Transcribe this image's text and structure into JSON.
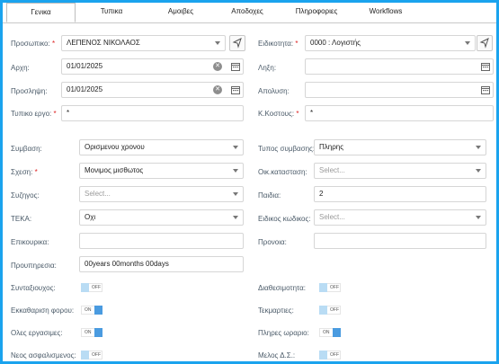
{
  "tabs": [
    "Γενικα",
    "Τυπικα",
    "Αμοιβες",
    "Αποδοχες",
    "Πληροφοριες",
    "Workflows"
  ],
  "form": {
    "prosopiko": {
      "label": "Προσωπικο:",
      "value": "ΛΕΠΕΝΟΣ ΝΙΚΟΛΑΟΣ"
    },
    "eidikotita": {
      "label": "Ειδικοτητα:",
      "value": "0000 : Λογιστής"
    },
    "arxi": {
      "label": "Αρχη:",
      "value": "01/01/2025"
    },
    "lixi": {
      "label": "Ληξη:",
      "value": ""
    },
    "proslipsi": {
      "label": "Προσληψη:",
      "value": "01/01/2025"
    },
    "apolysi": {
      "label": "Απολυση:",
      "value": ""
    },
    "typiko_ergo": {
      "label": "Τυπικο εργο:",
      "value": "*"
    },
    "kostous": {
      "label": "Κ.Κοστους:",
      "value": "*"
    },
    "symvasi": {
      "label": "Συμβαση:",
      "value": "Ορισμενου χρονου"
    },
    "typos_symvasis": {
      "label": "Τυπος συμβασης:",
      "value": "Πληρης"
    },
    "schesi": {
      "label": "Σχεση:",
      "value": "Μονιμος μισθωτος"
    },
    "oik_katastasi": {
      "label": "Οικ.κατασταση:",
      "placeholder": "Select..."
    },
    "syzygos": {
      "label": "Συζηγος:",
      "placeholder": "Select..."
    },
    "paidia": {
      "label": "Παιδια:",
      "value": "2"
    },
    "teka": {
      "label": "ΤΕΚΑ:",
      "value": "Οχι"
    },
    "eidikos_kodikos": {
      "label": "Ειδικος κωδικος:",
      "placeholder": "Select..."
    },
    "epikourika": {
      "label": "Επικουρικα:",
      "value": ""
    },
    "pronoia": {
      "label": "Προνοια:",
      "value": ""
    },
    "proypiresia": {
      "label": "Προυπηρεσια:",
      "value": "00years 00months 00days"
    }
  },
  "toggles": {
    "syntaxiouxos": {
      "label": "Συνταξιουχος:",
      "state": "OFF"
    },
    "diathesimotita": {
      "label": "Διαθεσιμοτητα:",
      "state": "OFF"
    },
    "ekkatharisi": {
      "label": "Εκκαθαριση φορου:",
      "state": "ON"
    },
    "tekmarties": {
      "label": "Τεκμαρτιες:",
      "state": "OFF"
    },
    "oles_ergasimes": {
      "label": "Ολες εργασιμες:",
      "state": "ON"
    },
    "pliris_orario": {
      "label": "Πληρες ωραριο:",
      "state": "ON"
    },
    "neos_asfalismenos": {
      "label": "Νεος ασφαλισμενος:",
      "state": "OFF"
    },
    "melos_ds": {
      "label": "Μελος Δ.Σ.:",
      "state": "OFF"
    }
  },
  "clear_glyph": "✕",
  "colors": {
    "accent": "#1aa3ee",
    "toggle_on": "#4a9be0",
    "toggle_off": "#b9dcf4",
    "required": "#d22222"
  }
}
